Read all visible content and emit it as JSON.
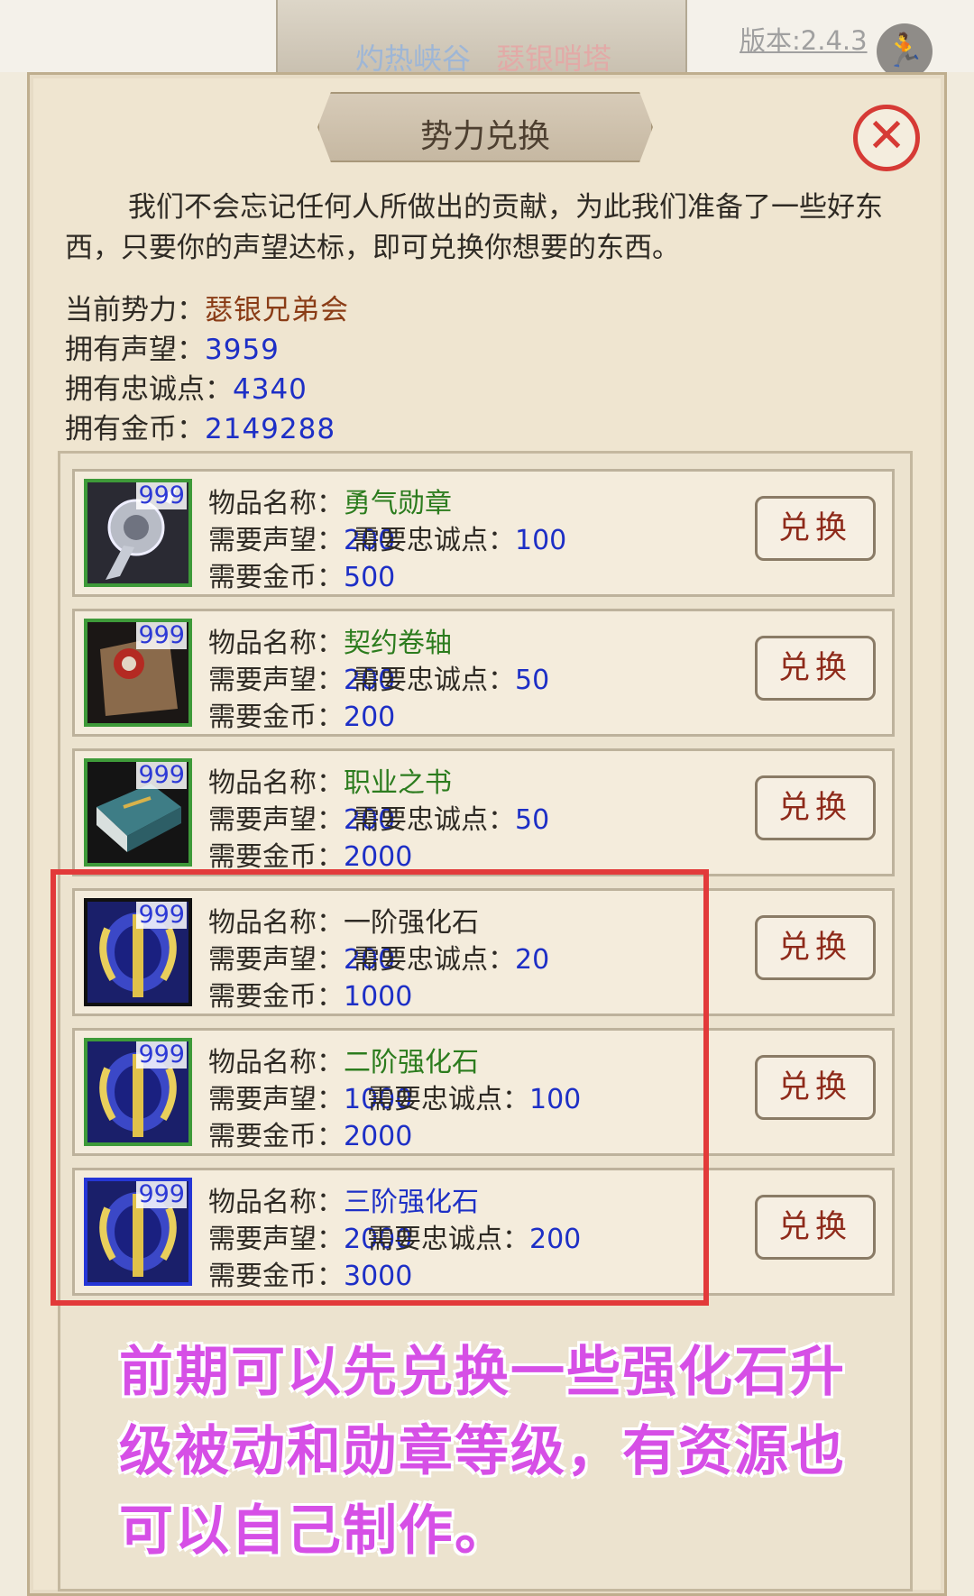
{
  "top": {
    "tab_left": "灼热峡谷",
    "tab_right": "瑟银哨塔",
    "version": "版本:2.4.3",
    "exit_icon": "running-man-icon"
  },
  "dialog": {
    "title": "势力兑换",
    "close_icon": "close-icon",
    "intro": "我们不会忘记任何人所做出的贡献，为此我们准备了一些好东西，只要你的声望达标，即可兑换你想要的东西。",
    "faction_label": "当前势力：",
    "faction_value": "瑟银兄弟会",
    "reputation_label": "拥有声望：",
    "reputation_value": "3959",
    "loyalty_label": "拥有忠诚点：",
    "loyalty_value": "4340",
    "gold_label": "拥有金币：",
    "gold_value": "2149288"
  },
  "labels": {
    "name": "物品名称：",
    "rep": "需要声望：",
    "loyal": "需要忠诚点：",
    "gold": "需要金币：",
    "button": "兑换"
  },
  "items": [
    {
      "name": "勇气勋章",
      "count": "999",
      "rep": "200",
      "loyal": "100",
      "gold": "500",
      "icon": "medal-icon"
    },
    {
      "name": "契约卷轴",
      "count": "999",
      "rep": "200",
      "loyal": "50",
      "gold": "200",
      "icon": "scroll-icon"
    },
    {
      "name": "职业之书",
      "count": "999",
      "rep": "200",
      "loyal": "50",
      "gold": "2000",
      "icon": "book-icon"
    },
    {
      "name": "一阶强化石",
      "count": "999",
      "rep": "200",
      "loyal": "20",
      "gold": "1000",
      "icon": "forge-stone-icon"
    },
    {
      "name": "二阶强化石",
      "count": "999",
      "rep": "1000",
      "loyal": "100",
      "gold": "2000",
      "icon": "forge-stone-icon"
    },
    {
      "name": "三阶强化石",
      "count": "999",
      "rep": "2000",
      "loyal": "200",
      "gold": "3000",
      "icon": "forge-stone-icon"
    }
  ],
  "note": "前期可以先兑换一些强化石升级被动和勋章等级，有资源也可以自己制作。"
}
